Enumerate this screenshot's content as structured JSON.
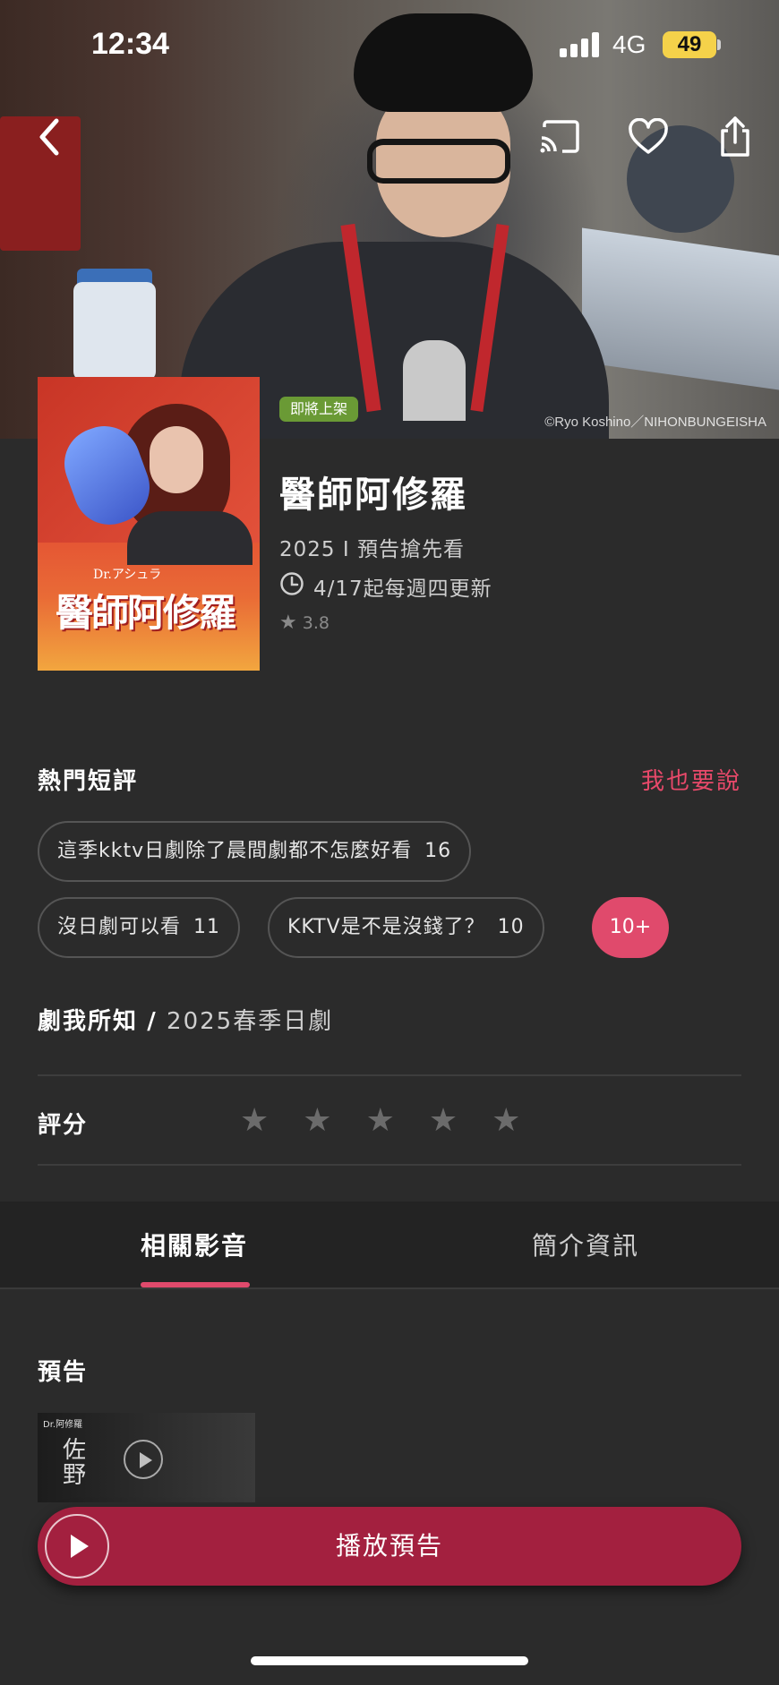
{
  "status_bar": {
    "time": "12:34",
    "network": "4G",
    "battery": "49"
  },
  "hero": {
    "copyright": "©Ryo Koshino／NIHONBUNGEISHA"
  },
  "poster": {
    "subtitle": "Dr.アシュラ",
    "title_text": "醫師阿修羅"
  },
  "show": {
    "badge": "即將上架",
    "title": "醫師阿修羅",
    "meta": "2025 I 預告搶先看",
    "update": "4/17起每週四更新",
    "rating": "3.8"
  },
  "reviews": {
    "title": "熱門短評",
    "action": "我也要說",
    "chips": [
      {
        "text": "這季kktv日劇除了晨間劇都不怎麼好看",
        "count": "16"
      },
      {
        "text": "沒日劇可以看",
        "count": "11"
      },
      {
        "text": "KKTV是不是沒錢了？",
        "count": "10"
      }
    ],
    "more": "10+"
  },
  "knowledge": {
    "label": "劇我所知",
    "separator": "/",
    "value": "2025春季日劇"
  },
  "score": {
    "label": "評分",
    "stars": [
      "★",
      "★",
      "★",
      "★",
      "★"
    ]
  },
  "tabs": [
    {
      "label": "相關影音",
      "active": true
    },
    {
      "label": "簡介資訊",
      "active": false
    }
  ],
  "trailer": {
    "section_title": "預告",
    "thumb_logo": "Dr.阿修羅",
    "thumb_chars": "佐\n野"
  },
  "play_button": {
    "label": "播放預告"
  },
  "colors": {
    "accent": "#e04a6c",
    "play": "#a3203f",
    "badge": "#6a9a35",
    "battery": "#f5d24a"
  },
  "icons": [
    "back-icon",
    "cast-icon",
    "heart-icon",
    "share-icon",
    "clock-icon",
    "star-icon",
    "play-icon"
  ]
}
